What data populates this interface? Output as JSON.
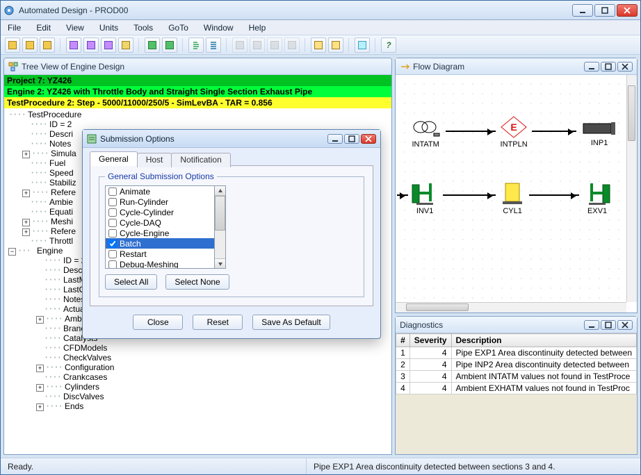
{
  "window": {
    "title": "Automated Design - PROD00"
  },
  "menu": [
    "File",
    "Edit",
    "View",
    "Units",
    "Tools",
    "GoTo",
    "Window",
    "Help"
  ],
  "tree_panel": {
    "title": "Tree View of Engine Design",
    "rows": {
      "project": "Project 7: YZ426",
      "engine": "Engine 2: YZ426 with Throttle Body and Straight Single Section Exhaust Pipe",
      "test": "TestProcedure 2: Step - 5000/11000/250/5 - SimLevBA - TAR = 0.856"
    },
    "root": "TestProcedure",
    "items_top": [
      {
        "expander": " ",
        "label": "ID = 2"
      },
      {
        "expander": " ",
        "label": "Descri"
      },
      {
        "expander": " ",
        "label": "Notes"
      },
      {
        "expander": "+",
        "label": "Simula"
      },
      {
        "expander": " ",
        "label": "Fuel"
      },
      {
        "expander": " ",
        "label": "Speed"
      },
      {
        "expander": " ",
        "label": "Stabiliz"
      },
      {
        "expander": "+",
        "label": "Refere"
      },
      {
        "expander": " ",
        "label": "Ambie"
      },
      {
        "expander": " ",
        "label": "Equati"
      },
      {
        "expander": "+",
        "label": "Meshi"
      },
      {
        "expander": "+",
        "label": "Refere"
      },
      {
        "expander": " ",
        "label": "Throttl"
      }
    ],
    "engine_label": "Engine",
    "items_engine": [
      {
        "expander": " ",
        "label": "ID = 2"
      },
      {
        "expander": " ",
        "label": "Descri"
      },
      {
        "expander": " ",
        "label": "LastM"
      },
      {
        "expander": " ",
        "label": "LastO"
      },
      {
        "expander": " ",
        "label": "Notes"
      },
      {
        "expander": " ",
        "label": "Actua"
      },
      {
        "expander": "+",
        "label": "Ambients"
      },
      {
        "expander": " ",
        "label": "Branches"
      },
      {
        "expander": " ",
        "label": "Catalysts"
      },
      {
        "expander": " ",
        "label": "CFDModels"
      },
      {
        "expander": " ",
        "label": "CheckValves"
      },
      {
        "expander": "+",
        "label": "Configuration"
      },
      {
        "expander": " ",
        "label": "Crankcases"
      },
      {
        "expander": "+",
        "label": "Cylinders"
      },
      {
        "expander": " ",
        "label": "DiscValves"
      },
      {
        "expander": "+",
        "label": "Ends"
      }
    ]
  },
  "flow_panel": {
    "title": "Flow Diagram",
    "nodes": {
      "intatm": "INTATM",
      "intpln": "INTPLN",
      "inp1": "INP1",
      "inv1": "INV1",
      "cyl1": "CYL1",
      "exv1": "EXV1"
    }
  },
  "diag_panel": {
    "title": "Diagnostics",
    "cols": {
      "num": "#",
      "sev": "Severity",
      "desc": "Description"
    },
    "rows": [
      {
        "n": "1",
        "sev": "4",
        "desc": "Pipe EXP1 Area discontinuity detected between"
      },
      {
        "n": "2",
        "sev": "4",
        "desc": "Pipe INP2 Area discontinuity detected between"
      },
      {
        "n": "3",
        "sev": "4",
        "desc": "Ambient INTATM values not found in TestProce"
      },
      {
        "n": "4",
        "sev": "4",
        "desc": "Ambient EXHATM values not found in TestProc"
      }
    ]
  },
  "dialog": {
    "title": "Submission Options",
    "tabs": {
      "general": "General",
      "host": "Host",
      "notif": "Notification"
    },
    "group_title": "General Submission Options",
    "options": [
      {
        "label": "Animate",
        "checked": false,
        "sel": false
      },
      {
        "label": "Run-Cylinder",
        "checked": false,
        "sel": false
      },
      {
        "label": "Cycle-Cylinder",
        "checked": false,
        "sel": false
      },
      {
        "label": "Cycle-DAQ",
        "checked": false,
        "sel": false
      },
      {
        "label": "Cycle-Engine",
        "checked": false,
        "sel": false
      },
      {
        "label": "Batch",
        "checked": true,
        "sel": true
      },
      {
        "label": "Restart",
        "checked": false,
        "sel": false
      },
      {
        "label": "Debug-Meshing",
        "checked": false,
        "sel": false
      }
    ],
    "buttons": {
      "select_all": "Select All",
      "select_none": "Select None",
      "close": "Close",
      "reset": "Reset",
      "save_default": "Save As Default"
    }
  },
  "status": {
    "left": "Ready.",
    "right": "Pipe EXP1 Area discontinuity detected between sections 3 and 4."
  }
}
